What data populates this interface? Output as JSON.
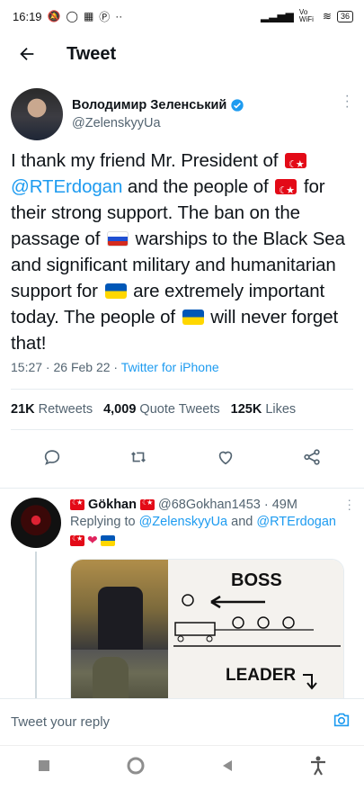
{
  "status_bar": {
    "time": "16:19",
    "network": "Vo WiFi",
    "battery": "36"
  },
  "header": {
    "title": "Tweet"
  },
  "tweet": {
    "display_name": "Володимир Зеленський",
    "handle": "@ZelenskyyUa",
    "text_parts": [
      "I thank my friend Mr. President of",
      "@RTErdogan",
      "and the people of",
      "for their strong support. The ban on the passage of",
      "warships to the Black Sea and significant military and humanitarian support for",
      "are extremely important today. The people of",
      "will never forget that!"
    ],
    "timestamp": "15:27 · 26 Feb 22 · ",
    "source": "Twitter for iPhone",
    "retweets_count": "21K",
    "retweets_label": "Retweets",
    "quotes_count": "4,009",
    "quotes_label": "Quote Tweets",
    "likes_count": "125K",
    "likes_label": "Likes"
  },
  "reply": {
    "display_name": "Gökhan",
    "handle": "@68Gokhan1453",
    "time": "· 49M",
    "replying_prefix": "Replying to",
    "replying_to_1": "@ZelenskyyUa",
    "replying_and": "and",
    "replying_to_2": "@RTErdogan",
    "meme_boss": "BOSS",
    "meme_leader": "LEADER"
  },
  "composer": {
    "placeholder": "Tweet your reply"
  },
  "icons": {
    "back": "arrow-left-icon",
    "verified": "verified-badge-icon",
    "reply": "reply-icon",
    "retweet": "retweet-icon",
    "like": "heart-icon",
    "share": "share-icon",
    "camera": "camera-icon"
  },
  "colors": {
    "accent": "#1d9bf0",
    "text": "#0f1419",
    "secondary": "#536471"
  }
}
